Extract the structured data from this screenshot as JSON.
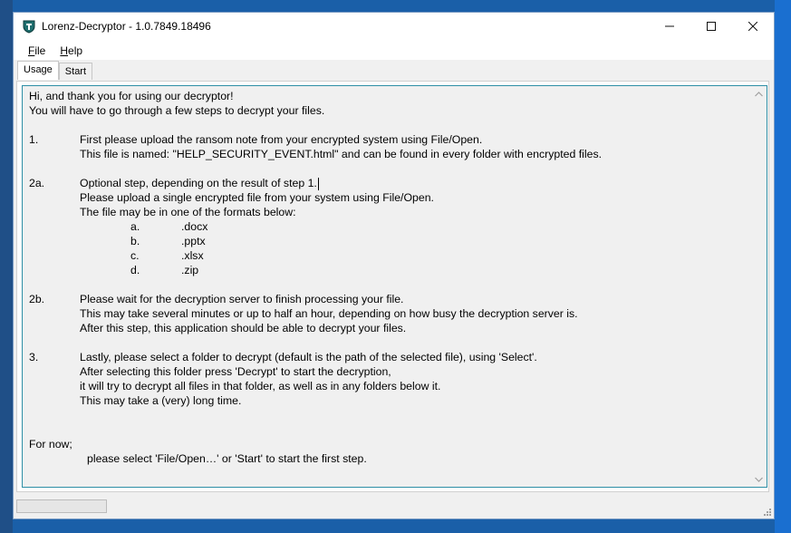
{
  "window": {
    "title": "Lorenz-Decryptor - 1.0.7849.18496",
    "minimize_label": "—",
    "maximize_label": "☐",
    "close_label": "✕"
  },
  "menu": {
    "file": {
      "accel": "F",
      "rest": "ile"
    },
    "help": {
      "accel": "H",
      "rest": "elp"
    }
  },
  "tabs": [
    {
      "label": "Usage",
      "active": true
    },
    {
      "label": "Start",
      "active": false
    }
  ],
  "usage": {
    "intro1": "Hi, and thank you for using our decryptor!",
    "intro2": "You will have to go through a few steps to decrypt your files.",
    "step1": {
      "num": "1.",
      "l1": "First please upload the ransom note from your encrypted system using File/Open.",
      "l2": "This file is named: \"HELP_SECURITY_EVENT.html\" and can be found in every folder with encrypted files."
    },
    "step2a": {
      "num": "2a.",
      "l1": "Optional step, depending on the result of step 1.",
      "l2": "Please upload a single encrypted file from your system using File/Open.",
      "l3": "The file may be in one of the formats below:",
      "formats": [
        {
          "letter": "a.",
          "ext": ".docx"
        },
        {
          "letter": "b.",
          "ext": ".pptx"
        },
        {
          "letter": "c.",
          "ext": ".xlsx"
        },
        {
          "letter": "d.",
          "ext": ".zip"
        }
      ]
    },
    "step2b": {
      "num": "2b.",
      "l1": "Please wait for the decryption server to finish processing your file.",
      "l2": "This may take several minutes or up to half an hour, depending on how busy the decryption server is.",
      "l3": "After this step, this application should be able to decrypt your files."
    },
    "step3": {
      "num": "3.",
      "l1": "Lastly, please select a folder to decrypt (default is the path of the selected file), using 'Select'.",
      "l2": "After selecting this folder press 'Decrypt' to start the decryption,",
      "l3": "it will try to decrypt all files in that folder, as well as in any folders below it.",
      "l4": "This may take a (very) long time."
    },
    "for_now": "For now;",
    "final": "please select 'File/Open…' or 'Start' to start the first step."
  },
  "icons": {
    "app": "lorenz-shield-icon",
    "scroll_up": "scroll-up-icon",
    "scroll_down": "scroll-down-icon",
    "size_grip": "size-grip-icon"
  }
}
